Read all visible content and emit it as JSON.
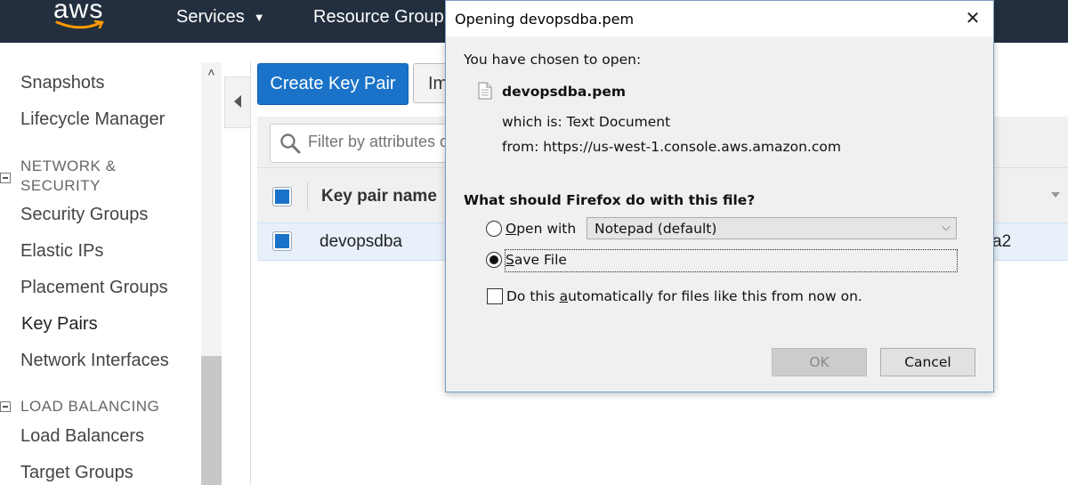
{
  "topbar": {
    "logo_text": "aws",
    "services_label": "Services",
    "resource_groups_label": "Resource Group"
  },
  "sidebar": {
    "items": [
      {
        "label": "Snapshots"
      },
      {
        "label": "Lifecycle Manager"
      }
    ],
    "network_heading": "NETWORK & SECURITY",
    "network_items": [
      {
        "label": "Security Groups"
      },
      {
        "label": "Elastic IPs"
      },
      {
        "label": "Placement Groups"
      },
      {
        "label": "Key Pairs"
      },
      {
        "label": "Network Interfaces"
      }
    ],
    "lb_heading": "LOAD BALANCING",
    "lb_items": [
      {
        "label": "Load Balancers"
      },
      {
        "label": "Target Groups"
      }
    ]
  },
  "main": {
    "create_button": "Create Key Pair",
    "import_button": "Im",
    "filter_placeholder": "Filter by attributes o",
    "column_header": "Key pair name",
    "rows": [
      {
        "name": "devopsdba",
        "tail": "a2"
      }
    ]
  },
  "dialog": {
    "title": "Opening devopsdba.pem",
    "chosen_text": "You have chosen to open:",
    "filename": "devopsdba.pem",
    "which_is_label": "which is:",
    "which_is_value": "Text Document",
    "from_label": "from:",
    "from_value": "https://us-west-1.console.aws.amazon.com",
    "question": "What should Firefox do with this file?",
    "open_with_first": "O",
    "open_with_rest": "pen with",
    "open_with_value": "Notepad (default)",
    "save_first": "S",
    "save_rest": "ave File",
    "auto_pre": "Do this ",
    "auto_u": "a",
    "auto_post": "utomatically for files like this from now on.",
    "ok_label": "OK",
    "cancel_label": "Cancel",
    "selected_option": "Save File"
  }
}
